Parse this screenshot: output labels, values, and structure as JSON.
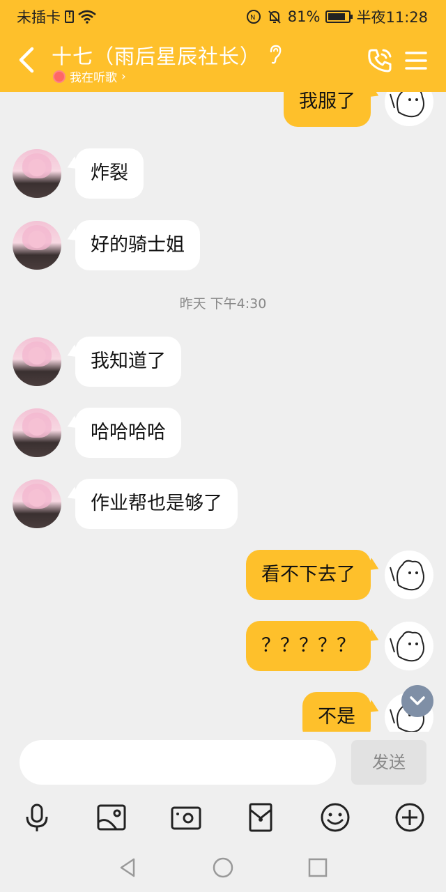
{
  "status_bar": {
    "carrier": "未插卡",
    "battery_percent": "81%",
    "time": "半夜11:28"
  },
  "header": {
    "title": "十七（雨后星辰社长）",
    "subtitle": "我在听歌",
    "subtitle_arrow": "›"
  },
  "messages": [
    {
      "side": "out",
      "text": "我服了"
    },
    {
      "side": "in",
      "text": "炸裂"
    },
    {
      "side": "in",
      "text": "好的骑士姐"
    },
    {
      "type": "timestamp",
      "text": "昨天 下午4:30"
    },
    {
      "side": "in",
      "text": "我知道了"
    },
    {
      "side": "in",
      "text": "哈哈哈哈"
    },
    {
      "side": "in",
      "text": "作业帮也是够了"
    },
    {
      "side": "out",
      "text": "看不下去了"
    },
    {
      "side": "out",
      "text": "？？？？？"
    },
    {
      "side": "out",
      "text": "不是"
    }
  ],
  "input": {
    "value": "",
    "send_label": "发送"
  },
  "toolbar_icons": [
    "microphone-icon",
    "image-icon",
    "camera-icon",
    "red-packet-icon",
    "emoji-icon",
    "plus-icon"
  ],
  "nav_icons": [
    "back-triangle-icon",
    "home-circle-icon",
    "recent-square-icon"
  ],
  "colors": {
    "accent": "#fec02b",
    "background": "#efefef",
    "bubble_in": "#ffffff",
    "timestamp": "#888888"
  }
}
